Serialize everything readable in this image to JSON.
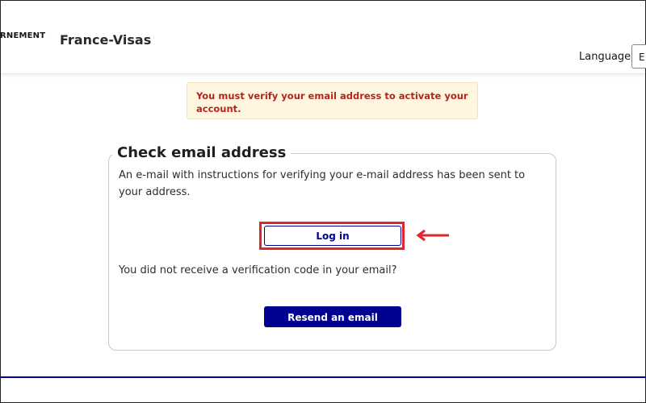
{
  "header": {
    "gov_label": "RNEMENT",
    "site_title": "France-Visas",
    "language_label": "Language :",
    "language_value": "E"
  },
  "alert": {
    "message": "You must verify your email address to activate your account."
  },
  "card": {
    "title": "Check email address",
    "body": "An e-mail with instructions for verifying your e-mail address has been sent to your address.",
    "login_label": "Log in",
    "not_received": "You did not receive a verification code in your email?",
    "resend_label": "Resend an email"
  },
  "colors": {
    "primary": "#000091",
    "alert_text": "#b3261e",
    "alert_bg": "#fff6e0",
    "highlight": "#e3242b"
  }
}
